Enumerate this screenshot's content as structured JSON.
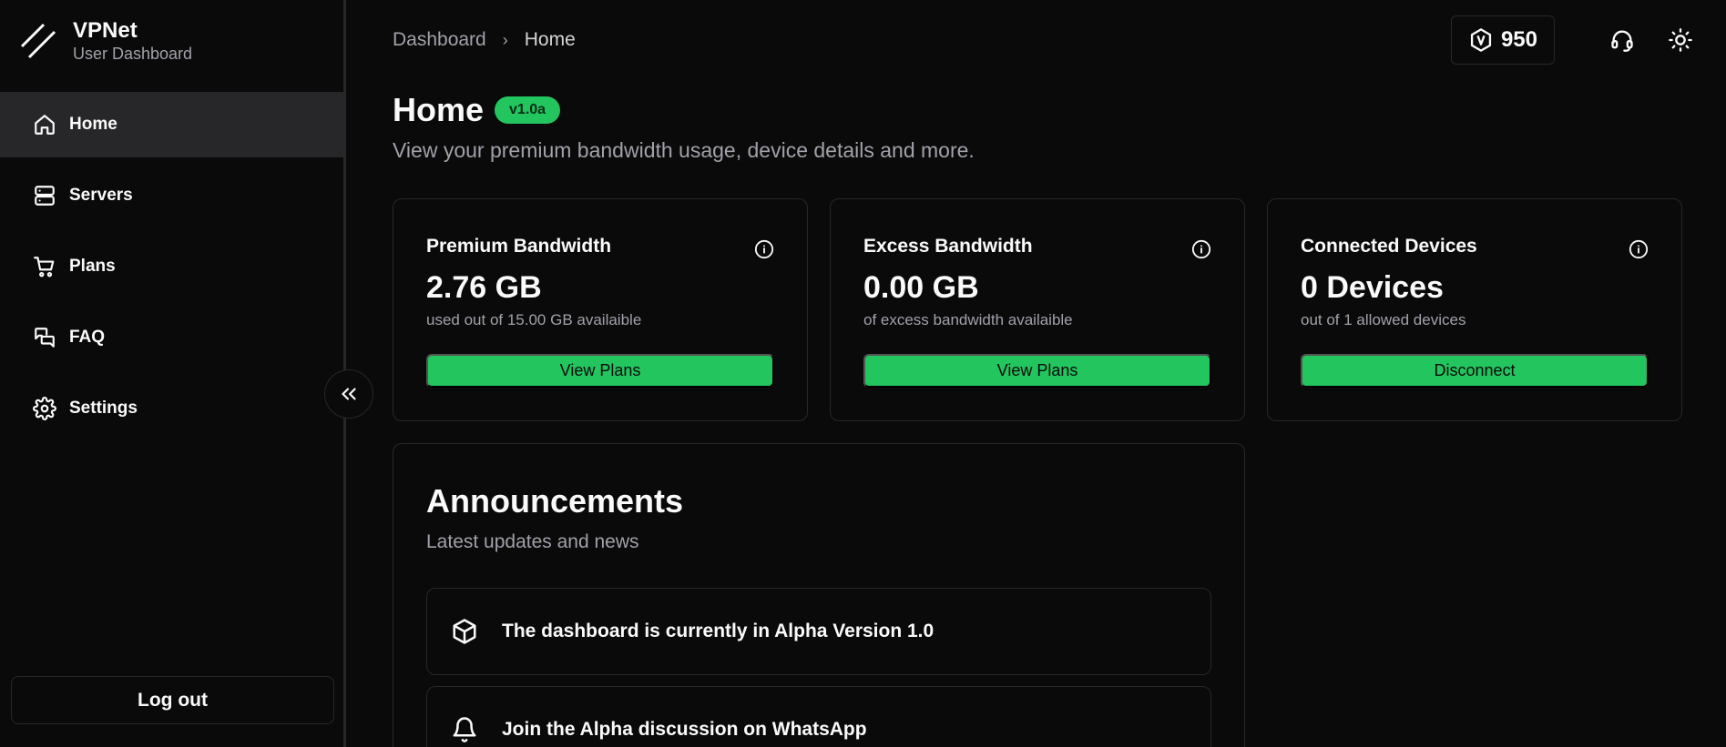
{
  "brand": {
    "name": "VPNet",
    "subtitle": "User Dashboard"
  },
  "sidebar": {
    "items": [
      {
        "label": "Home",
        "icon": "home-icon",
        "active": true
      },
      {
        "label": "Servers",
        "icon": "server-icon",
        "active": false
      },
      {
        "label": "Plans",
        "icon": "cart-icon",
        "active": false
      },
      {
        "label": "FAQ",
        "icon": "messages-icon",
        "active": false
      },
      {
        "label": "Settings",
        "icon": "gear-icon",
        "active": false
      }
    ],
    "logout_label": "Log out"
  },
  "breadcrumb": {
    "root": "Dashboard",
    "current": "Home"
  },
  "topbar": {
    "credits": "950"
  },
  "page": {
    "title": "Home",
    "version_badge": "v1.0a",
    "subtitle": "View your premium bandwidth usage, device details and more."
  },
  "cards": [
    {
      "title": "Premium Bandwidth",
      "value": "2.76 GB",
      "desc": "used out of 15.00 GB availaible",
      "button": "View Plans"
    },
    {
      "title": "Excess Bandwidth",
      "value": "0.00 GB",
      "desc": "of excess bandwidth availaible",
      "button": "View Plans"
    },
    {
      "title": "Connected Devices",
      "value": "0 Devices",
      "desc": "out of 1 allowed devices",
      "button": "Disconnect"
    }
  ],
  "announcements": {
    "title": "Announcements",
    "subtitle": "Latest updates and news",
    "items": [
      {
        "text": "The dashboard is currently in Alpha Version 1.0",
        "icon": "box-icon"
      },
      {
        "text": "Join the Alpha discussion on WhatsApp",
        "icon": "bell-icon"
      }
    ]
  },
  "colors": {
    "accent": "#22c55e",
    "background": "#0a0a0a",
    "border": "#27272a",
    "muted_text": "#a1a1aa"
  }
}
